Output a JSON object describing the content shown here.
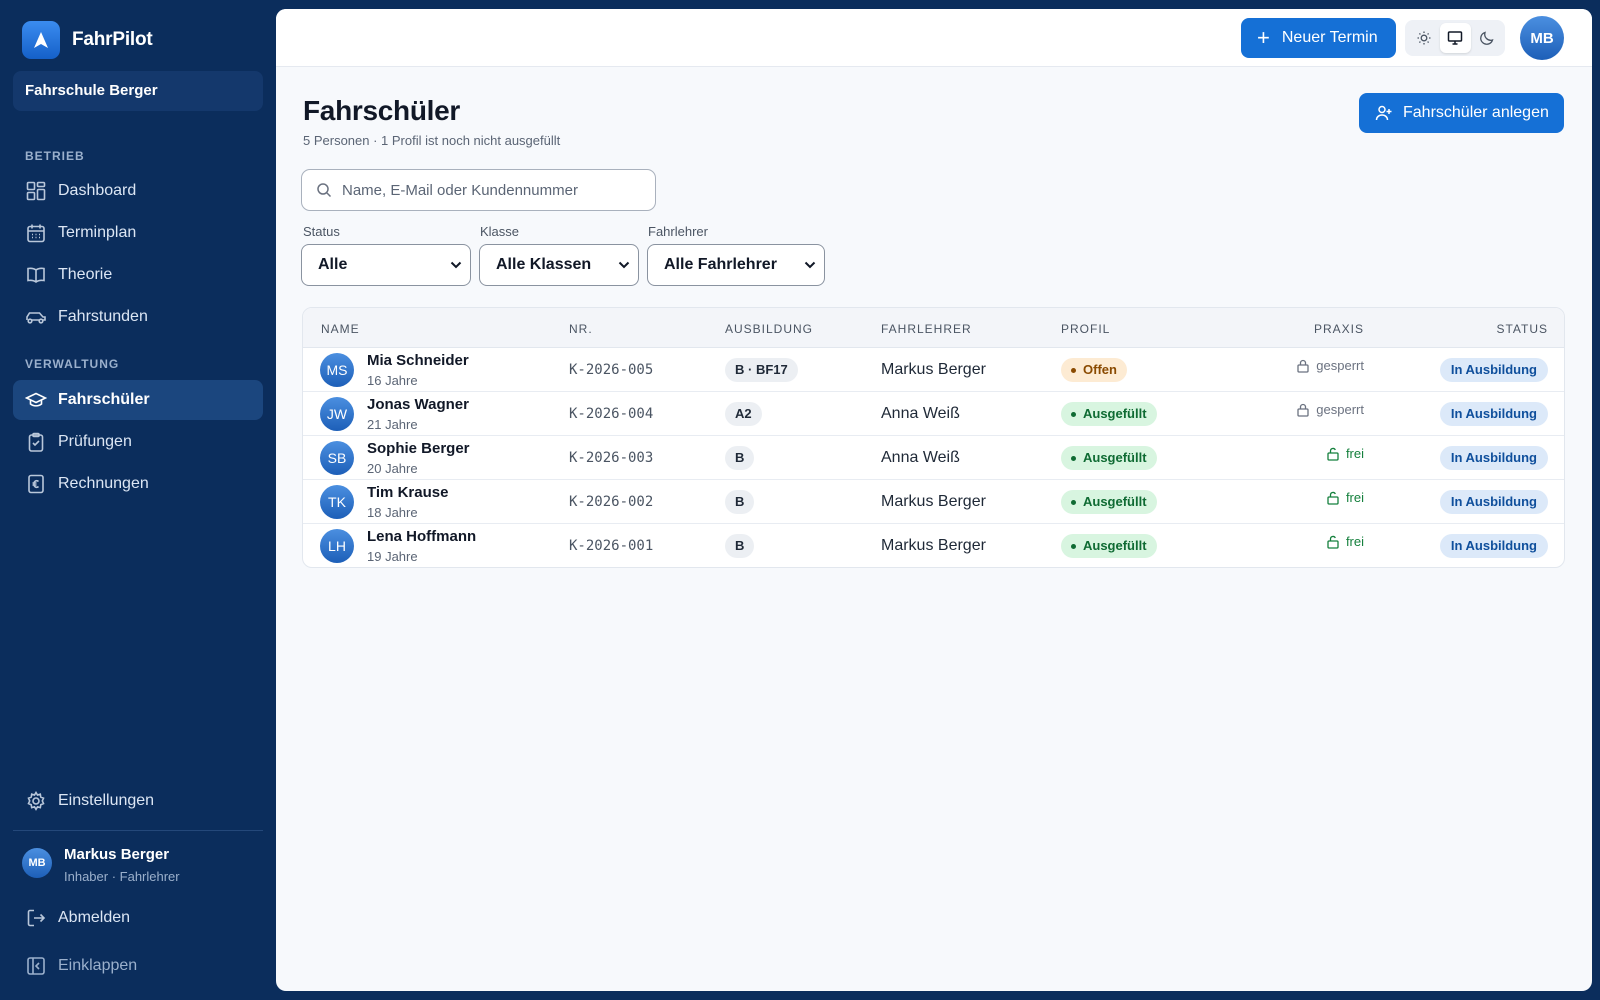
{
  "app": {
    "name": "FahrPilot",
    "school": "Fahrschule Berger"
  },
  "sidebar": {
    "sections": [
      "BETRIEB",
      "VERWALTUNG"
    ],
    "items": [
      {
        "label": "Dashboard",
        "icon": "dashboard-icon"
      },
      {
        "label": "Terminplan",
        "icon": "calendar-icon"
      },
      {
        "label": "Theorie",
        "icon": "book-icon"
      },
      {
        "label": "Fahrstunden",
        "icon": "car-icon"
      },
      {
        "label": "Fahrschüler",
        "icon": "graduation-cap-icon",
        "active": true
      },
      {
        "label": "Prüfungen",
        "icon": "clipboard-check-icon"
      },
      {
        "label": "Rechnungen",
        "icon": "euro-receipt-icon"
      }
    ],
    "settings": "Einstellungen",
    "user": {
      "initials": "MB",
      "name": "Markus Berger",
      "role": "Inhaber · Fahrlehrer"
    },
    "logout": "Abmelden",
    "collapse": "Einklappen"
  },
  "topbar": {
    "new_appointment": "Neuer Termin",
    "theme_modes": [
      "light",
      "system",
      "dark"
    ],
    "selected_theme": "system",
    "avatar": "MB"
  },
  "page": {
    "title": "Fahrschüler",
    "subtitle": "5 Personen · 1 Profil ist noch nicht ausgefüllt",
    "add_button": "Fahrschüler anlegen",
    "search_placeholder": "Name, E-Mail oder Kundennummer"
  },
  "filters": [
    {
      "label": "Status",
      "value": "Alle"
    },
    {
      "label": "Klasse",
      "value": "Alle Klassen"
    },
    {
      "label": "Fahrlehrer",
      "value": "Alle Fahrlehrer"
    }
  ],
  "table": {
    "columns": [
      "NAME",
      "NR.",
      "AUSBILDUNG",
      "FAHRLEHRER",
      "PROFIL",
      "PRAXIS",
      "STATUS"
    ],
    "rows": [
      {
        "initials": "MS",
        "name": "Mia Schneider",
        "age": "16 Jahre",
        "nr": "K-2026-005",
        "ausbildung": "B · BF17",
        "fahrlehrer": "Markus Berger",
        "profil": "Offen",
        "praxis": "gesperrt",
        "status": "In Ausbildung"
      },
      {
        "initials": "JW",
        "name": "Jonas Wagner",
        "age": "21 Jahre",
        "nr": "K-2026-004",
        "ausbildung": "A2",
        "fahrlehrer": "Anna Weiß",
        "profil": "Ausgefüllt",
        "praxis": "gesperrt",
        "status": "In Ausbildung"
      },
      {
        "initials": "SB",
        "name": "Sophie Berger",
        "age": "20 Jahre",
        "nr": "K-2026-003",
        "ausbildung": "B",
        "fahrlehrer": "Anna Weiß",
        "profil": "Ausgefüllt",
        "praxis": "frei",
        "status": "In Ausbildung"
      },
      {
        "initials": "TK",
        "name": "Tim Krause",
        "age": "18 Jahre",
        "nr": "K-2026-002",
        "ausbildung": "B",
        "fahrlehrer": "Markus Berger",
        "profil": "Ausgefüllt",
        "praxis": "frei",
        "status": "In Ausbildung"
      },
      {
        "initials": "LH",
        "name": "Lena Hoffmann",
        "age": "19 Jahre",
        "nr": "K-2026-001",
        "ausbildung": "B",
        "fahrlehrer": "Markus Berger",
        "profil": "Ausgefüllt",
        "praxis": "frei",
        "status": "In Ausbildung"
      }
    ]
  },
  "colors": {
    "sidebar": "#0b2d5c",
    "primary": "#1570d6",
    "locked": "#6b7280",
    "free": "#15803d"
  }
}
